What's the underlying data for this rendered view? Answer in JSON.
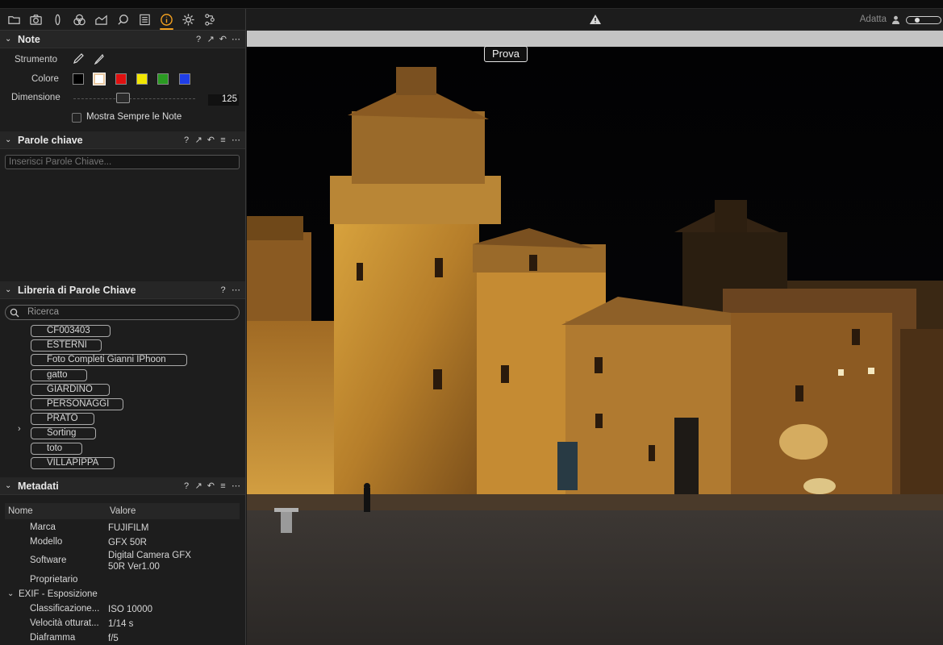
{
  "toolbar": {
    "icons": [
      "folder-icon",
      "camera-icon",
      "lens-icon",
      "color-icon",
      "exposure-icon",
      "search-icon",
      "details-icon",
      "info-icon",
      "settings-icon",
      "batch-icon"
    ],
    "active": "info-icon"
  },
  "note": {
    "title": "Note",
    "tool_label": "Strumento",
    "color_label": "Colore",
    "size_label": "Dimensione",
    "size_value": "125",
    "show_label": "Mostra Sempre le Note",
    "colors": [
      "#000000",
      "#ffffff",
      "#e01010",
      "#f2e600",
      "#2a9a22",
      "#1f3ee8"
    ]
  },
  "keywords": {
    "title": "Parole chiave",
    "placeholder": "Inserisci Parole Chiave..."
  },
  "library": {
    "title": "Libreria di Parole Chiave",
    "search_placeholder": "Ricerca",
    "items": [
      "CF003403",
      "ESTERNI",
      "Foto Completi Gianni IPhoon",
      "gatto",
      "GIARDINO",
      "PERSONAGGI",
      "PRATO",
      "Sorting",
      "toto",
      "VILLAPIPPA"
    ]
  },
  "metadata": {
    "title": "Metadati",
    "col_name": "Nome",
    "col_value": "Valore",
    "rows": [
      {
        "k": "Marca",
        "v": "FUJIFILM"
      },
      {
        "k": "Modello",
        "v": "GFX 50R"
      },
      {
        "k": "Software",
        "v": "Digital Camera GFX 50R Ver1.00"
      },
      {
        "k": "Proprietario",
        "v": ""
      }
    ],
    "section": "EXIF - Esposizione",
    "exif_rows": [
      {
        "k": "Classificazione...",
        "v": "ISO 10000"
      },
      {
        "k": "Velocità otturat...",
        "v": "1/14 s"
      },
      {
        "k": "Diaframma",
        "v": "f/5"
      }
    ]
  },
  "viewer": {
    "fit_label": "Adatta",
    "annotation": "Prova"
  }
}
